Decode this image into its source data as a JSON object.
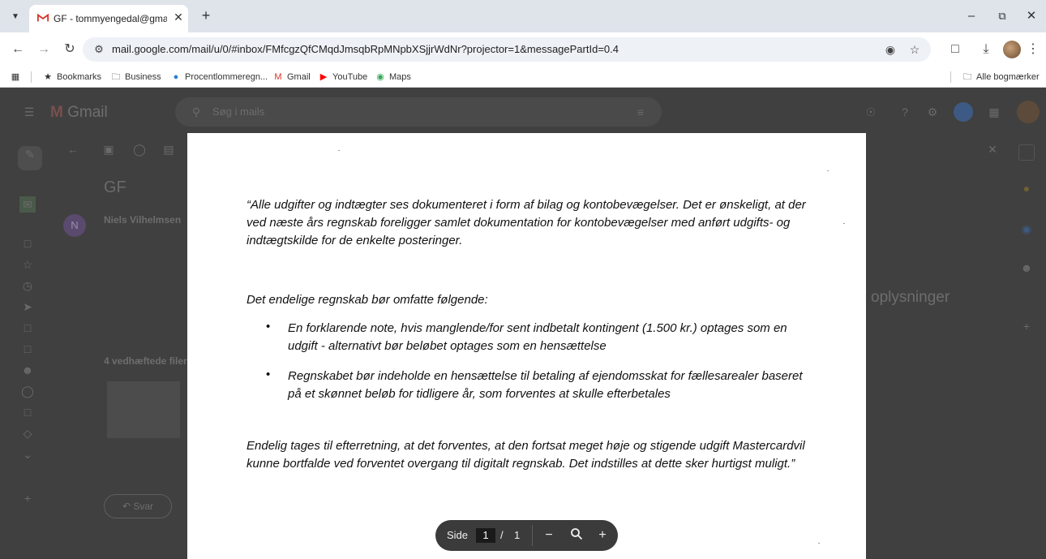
{
  "browser": {
    "tab": {
      "title": "GF - tommyengedal@gmail.com",
      "favicon_icon": "gmail-logo-icon"
    },
    "url": "mail.google.com/mail/u/0/#inbox/FMfcgzQfCMqdJmsqbRpMNpbXSjjrWdNr?projector=1&messagePartId=0.4",
    "bookmarks": [
      {
        "label": "Bookmarks",
        "icon": "star-icon"
      },
      {
        "label": "Business",
        "icon": "folder-icon"
      },
      {
        "label": "Procentlommeregn...",
        "icon": "calculator-icon"
      },
      {
        "label": "Gmail",
        "icon": "gmail-icon"
      },
      {
        "label": "YouTube",
        "icon": "youtube-icon"
      },
      {
        "label": "Maps",
        "icon": "maps-icon"
      }
    ],
    "all_bookmarks": "Alle bogmærker"
  },
  "gmail_background": {
    "app_name": "Gmail",
    "search_placeholder": "Søg i mails",
    "subject": "GF",
    "sender_name": "Niels Vilhelmsen",
    "sender_initial": "N",
    "attachments_label": "4 vedhæftede filer",
    "reply_label": "Svar",
    "side_text": "oplysninger"
  },
  "pdf": {
    "paragraph1": "“Alle udgifter og indtægter ses dokumenteret i form af bilag og kontobevægelser. Det er ønskeligt, at der ved næste års regnskab foreligger samlet dokumentation for kontobevægelser med anført udgifts- og indtægtskilde for de enkelte posteringer.",
    "paragraph2": "Det endelige regnskab bør omfatte følgende:",
    "bullets": [
      "En forklarende note, hvis manglende/for sent indbetalt kontingent (1.500 kr.) optages som en udgift - alternativt bør beløbet optages som en hensættelse",
      "Regnskabet bør indeholde en hensættelse til betaling af ejendomsskat for fællesarealer baseret på et skønnet beløb for tidligere år, som forventes at skulle efterbetales"
    ],
    "paragraph3": "Endelig tages til efterretning, at det forventes, at den fortsat meget høje og stigende udgift Mastercardvil kunne bortfalde ved forventet overgang til digitalt regnskab. Det indstilles at dette sker hurtigst muligt.”"
  },
  "pdf_toolbar": {
    "page_label": "Side",
    "current_page": "1",
    "separator": "/",
    "total_pages": "1",
    "zoom_out": "−",
    "zoom_in": "+"
  }
}
